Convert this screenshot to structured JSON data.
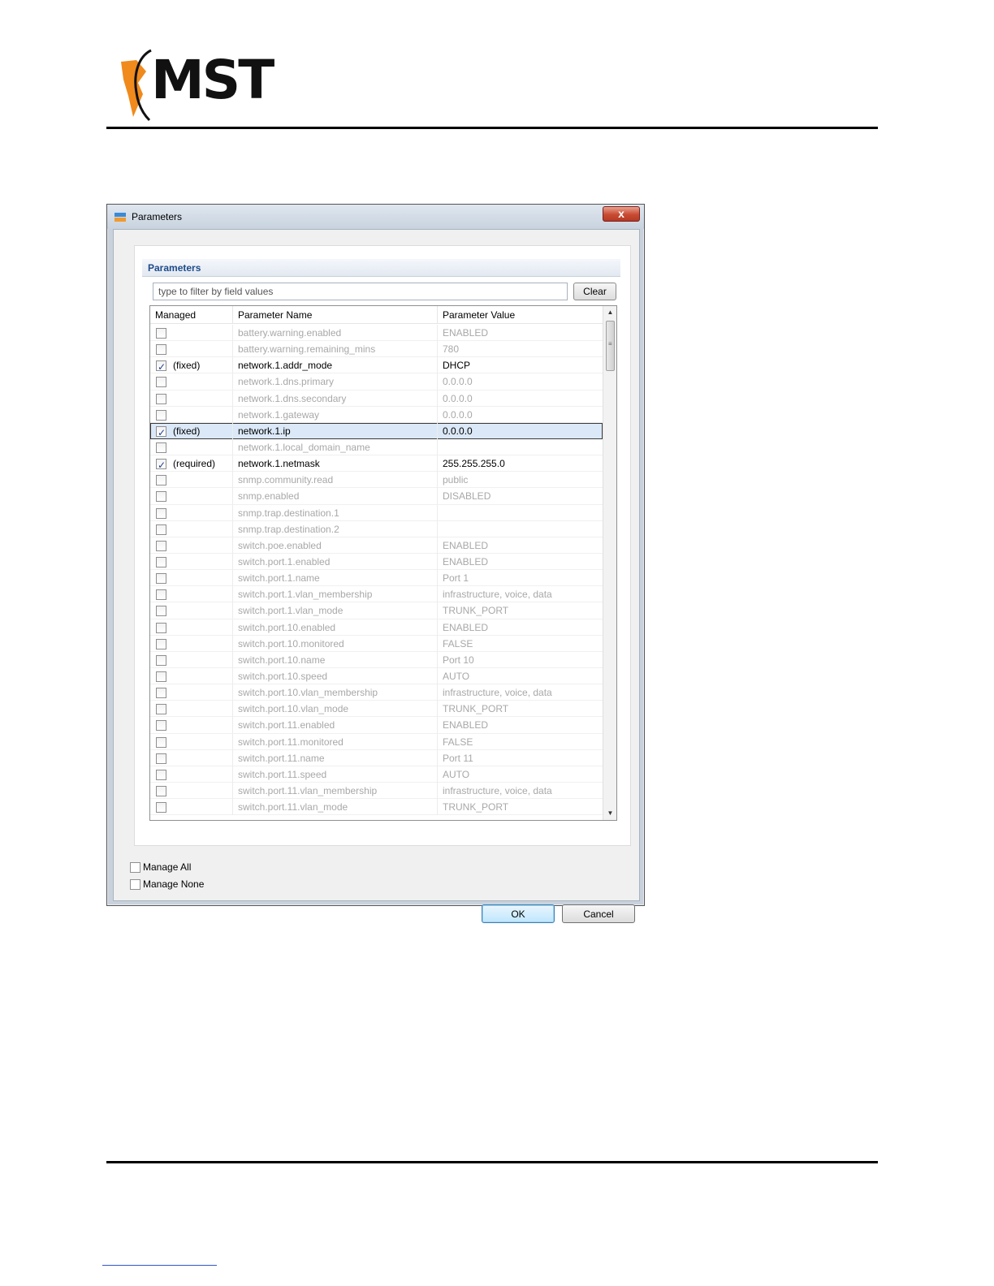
{
  "brand": {
    "logo_text": "MST",
    "accent_color": "#f08a1c"
  },
  "dialog": {
    "title": "Parameters",
    "close_symbol": "x",
    "section_title": "Parameters",
    "filter": {
      "placeholder": "type to filter by field values",
      "value": ""
    },
    "clear_label": "Clear",
    "columns": [
      "Managed",
      "Parameter Name",
      "Parameter Value"
    ],
    "rows": [
      {
        "checked": false,
        "managed": "",
        "name": "battery.warning.enabled",
        "value": "ENABLED"
      },
      {
        "checked": false,
        "managed": "",
        "name": "battery.warning.remaining_mins",
        "value": "780"
      },
      {
        "checked": true,
        "managed": "(fixed)",
        "name": "network.1.addr_mode",
        "value": "DHCP"
      },
      {
        "checked": false,
        "managed": "",
        "name": "network.1.dns.primary",
        "value": "0.0.0.0"
      },
      {
        "checked": false,
        "managed": "",
        "name": "network.1.dns.secondary",
        "value": "0.0.0.0"
      },
      {
        "checked": false,
        "managed": "",
        "name": "network.1.gateway",
        "value": "0.0.0.0"
      },
      {
        "checked": true,
        "managed": "(fixed)",
        "name": "network.1.ip",
        "value": "0.0.0.0",
        "selected": true
      },
      {
        "checked": false,
        "managed": "",
        "name": "network.1.local_domain_name",
        "value": ""
      },
      {
        "checked": true,
        "managed": "(required)",
        "name": "network.1.netmask",
        "value": "255.255.255.0"
      },
      {
        "checked": false,
        "managed": "",
        "name": "snmp.community.read",
        "value": "public"
      },
      {
        "checked": false,
        "managed": "",
        "name": "snmp.enabled",
        "value": "DISABLED"
      },
      {
        "checked": false,
        "managed": "",
        "name": "snmp.trap.destination.1",
        "value": ""
      },
      {
        "checked": false,
        "managed": "",
        "name": "snmp.trap.destination.2",
        "value": ""
      },
      {
        "checked": false,
        "managed": "",
        "name": "switch.poe.enabled",
        "value": "ENABLED"
      },
      {
        "checked": false,
        "managed": "",
        "name": "switch.port.1.enabled",
        "value": "ENABLED"
      },
      {
        "checked": false,
        "managed": "",
        "name": "switch.port.1.name",
        "value": "Port 1"
      },
      {
        "checked": false,
        "managed": "",
        "name": "switch.port.1.vlan_membership",
        "value": "infrastructure, voice, data"
      },
      {
        "checked": false,
        "managed": "",
        "name": "switch.port.1.vlan_mode",
        "value": "TRUNK_PORT"
      },
      {
        "checked": false,
        "managed": "",
        "name": "switch.port.10.enabled",
        "value": "ENABLED"
      },
      {
        "checked": false,
        "managed": "",
        "name": "switch.port.10.monitored",
        "value": "FALSE"
      },
      {
        "checked": false,
        "managed": "",
        "name": "switch.port.10.name",
        "value": "Port 10"
      },
      {
        "checked": false,
        "managed": "",
        "name": "switch.port.10.speed",
        "value": "AUTO"
      },
      {
        "checked": false,
        "managed": "",
        "name": "switch.port.10.vlan_membership",
        "value": "infrastructure, voice, data"
      },
      {
        "checked": false,
        "managed": "",
        "name": "switch.port.10.vlan_mode",
        "value": "TRUNK_PORT"
      },
      {
        "checked": false,
        "managed": "",
        "name": "switch.port.11.enabled",
        "value": "ENABLED"
      },
      {
        "checked": false,
        "managed": "",
        "name": "switch.port.11.monitored",
        "value": "FALSE"
      },
      {
        "checked": false,
        "managed": "",
        "name": "switch.port.11.name",
        "value": "Port 11"
      },
      {
        "checked": false,
        "managed": "",
        "name": "switch.port.11.speed",
        "value": "AUTO"
      },
      {
        "checked": false,
        "managed": "",
        "name": "switch.port.11.vlan_membership",
        "value": "infrastructure, voice, data"
      },
      {
        "checked": false,
        "managed": "",
        "name": "switch.port.11.vlan_mode",
        "value": "TRUNK_PORT"
      }
    ],
    "manage_all_label": "Manage All",
    "manage_none_label": "Manage None",
    "ok_label": "OK",
    "cancel_label": "Cancel"
  }
}
